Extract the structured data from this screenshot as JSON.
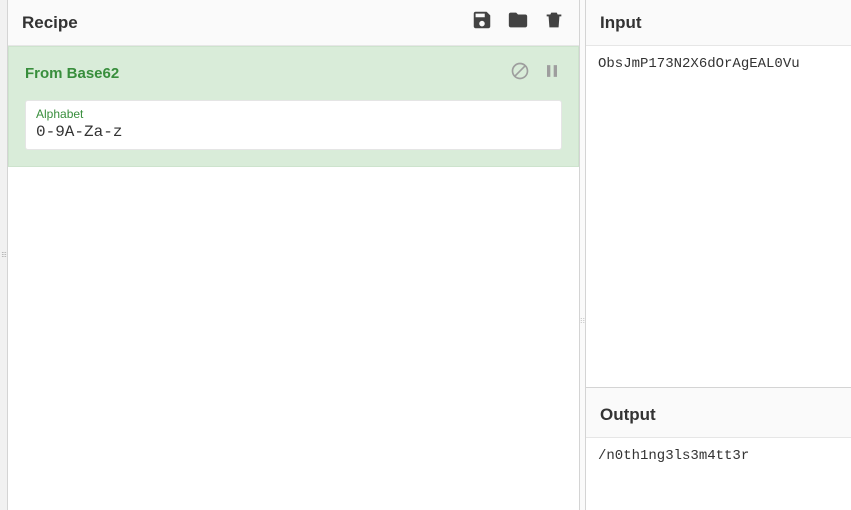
{
  "recipe": {
    "title": "Recipe",
    "operations": [
      {
        "name": "From Base62",
        "args": [
          {
            "label": "Alphabet",
            "value": "0-9A-Za-z"
          }
        ]
      }
    ]
  },
  "input": {
    "title": "Input",
    "value": "ObsJmP173N2X6dOrAgEAL0Vu"
  },
  "output": {
    "title": "Output",
    "value": "/n0th1ng3ls3m4tt3r"
  }
}
